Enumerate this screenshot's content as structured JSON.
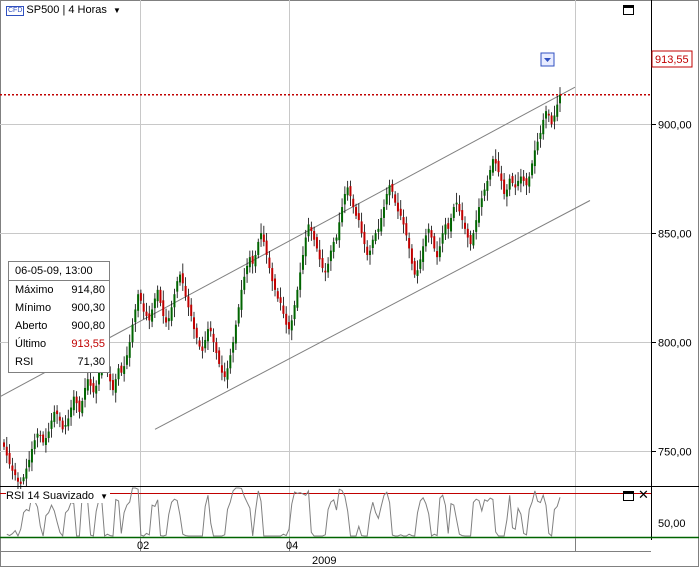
{
  "chart": {
    "symbol_badge": "CFD",
    "title": "SP500 | 4 Horas",
    "menu_glyph": "▼",
    "last_price_label": "913,55",
    "rsi_title": "RSI 14 Suavizado",
    "rsi_menu_glyph": "▼",
    "close_glyph": "✕"
  },
  "info_panel": {
    "datetime": "06-05-09, 13:00",
    "rows": [
      {
        "key": "Máximo",
        "value": "914,80"
      },
      {
        "key": "Mínimo",
        "value": "900,30"
      },
      {
        "key": "Aberto",
        "value": "900,80"
      },
      {
        "key": "Último",
        "value": "913,55"
      },
      {
        "key": "RSI",
        "value": "71,30"
      }
    ]
  },
  "colors": {
    "up_candle": "#006400",
    "down_candle": "#c00000",
    "last_line": "#c00000",
    "channel": "#808080",
    "grid": "#c8c8c8",
    "rsi_line": "#808080",
    "rsi_level": "#c00000",
    "time_axis_line": "#006400"
  },
  "chart_data": [
    {
      "type": "candlestick",
      "title": "SP500 | 4 Horas",
      "ylim": [
        734,
        957
      ],
      "yticks": [
        "750,00",
        "800,00",
        "850,00",
        "900,00"
      ],
      "ytick_values": [
        750,
        800,
        850,
        900
      ],
      "xticks": [
        "02",
        "04"
      ],
      "xaxis_year": "2009",
      "last": 913.55,
      "grid": true,
      "closes": [
        752,
        748,
        744,
        741,
        739,
        736,
        735,
        738,
        742,
        746,
        751,
        755,
        758,
        757,
        754,
        756,
        759,
        764,
        768,
        767,
        764,
        760,
        762,
        765,
        770,
        775,
        772,
        768,
        773,
        779,
        783,
        780,
        777,
        780,
        786,
        792,
        790,
        786,
        782,
        778,
        783,
        788,
        786,
        789,
        794,
        800,
        808,
        815,
        822,
        819,
        814,
        812,
        810,
        815,
        820,
        824,
        818,
        812,
        809,
        811,
        816,
        822,
        828,
        831,
        827,
        821,
        816,
        812,
        806,
        802,
        798,
        796,
        801,
        806,
        805,
        800,
        795,
        790,
        786,
        784,
        788,
        794,
        800,
        808,
        816,
        824,
        830,
        835,
        839,
        836,
        840,
        846,
        850,
        846,
        840,
        834,
        828,
        824,
        820,
        818,
        813,
        808,
        806,
        810,
        817,
        824,
        832,
        840,
        848,
        854,
        851,
        847,
        843,
        838,
        834,
        832,
        836,
        842,
        846,
        848,
        855,
        862,
        868,
        871,
        867,
        862,
        858,
        856,
        850,
        845,
        840,
        842,
        847,
        850,
        852,
        857,
        862,
        868,
        872,
        869,
        864,
        860,
        858,
        854,
        849,
        843,
        836,
        831,
        833,
        838,
        844,
        849,
        852,
        848,
        843,
        839,
        844,
        850,
        854,
        852,
        857,
        862,
        864,
        860,
        856,
        852,
        848,
        845,
        850,
        856,
        862,
        866,
        870,
        874,
        879,
        884,
        882,
        878,
        874,
        868,
        870,
        875,
        873,
        871,
        874,
        876,
        874,
        872,
        876,
        882,
        888,
        892,
        896,
        902,
        906,
        904,
        900,
        904,
        909,
        913.55
      ]
    },
    {
      "type": "line",
      "title": "RSI 14 Suavizado",
      "ylim": [
        45,
        63
      ],
      "yticks": [
        "50,00"
      ],
      "ytick_values": [
        50
      ],
      "level": 70,
      "last": 71.3
    }
  ]
}
